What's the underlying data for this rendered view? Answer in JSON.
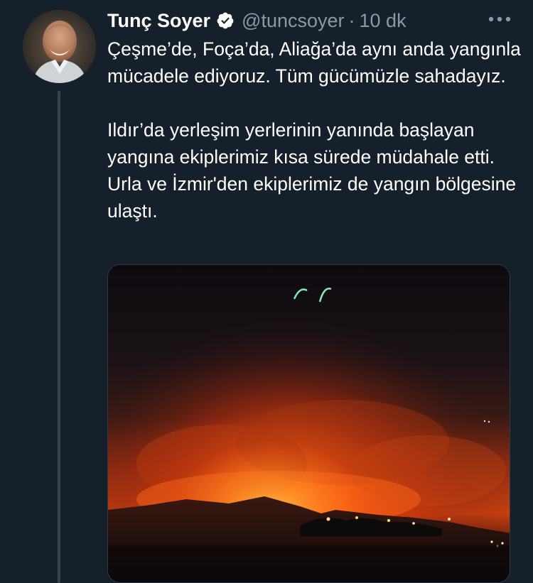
{
  "tweet": {
    "author": {
      "name": "Tunç Soyer",
      "handle": "@tuncsoyer",
      "verified": true,
      "avatar_icon": "profile-photo"
    },
    "separator": "·",
    "time": "10 dk",
    "more_icon": "more-horizontal-icon",
    "text": {
      "paragraph1": "Çeşme’de, Foça’da, Aliağa’da aynı anda yangınla mücadele ediyoruz. Tüm gücümüzle sahadayız.",
      "paragraph2": "Ildır’da yerleşim yerlerinin yanında başlayan yangına ekiplerimiz kısa sürede müdahale etti. Urla ve İzmir'den ekiplerimiz de yangın bölgesine ulaştı."
    },
    "media": {
      "type": "photo",
      "subject": "night-wildfire"
    }
  },
  "colors": {
    "background": "#15202b",
    "text_primary": "#ffffff",
    "text_secondary": "#8b98a5",
    "verified_badge": "#ffffff",
    "thread_line": "#38444d"
  }
}
